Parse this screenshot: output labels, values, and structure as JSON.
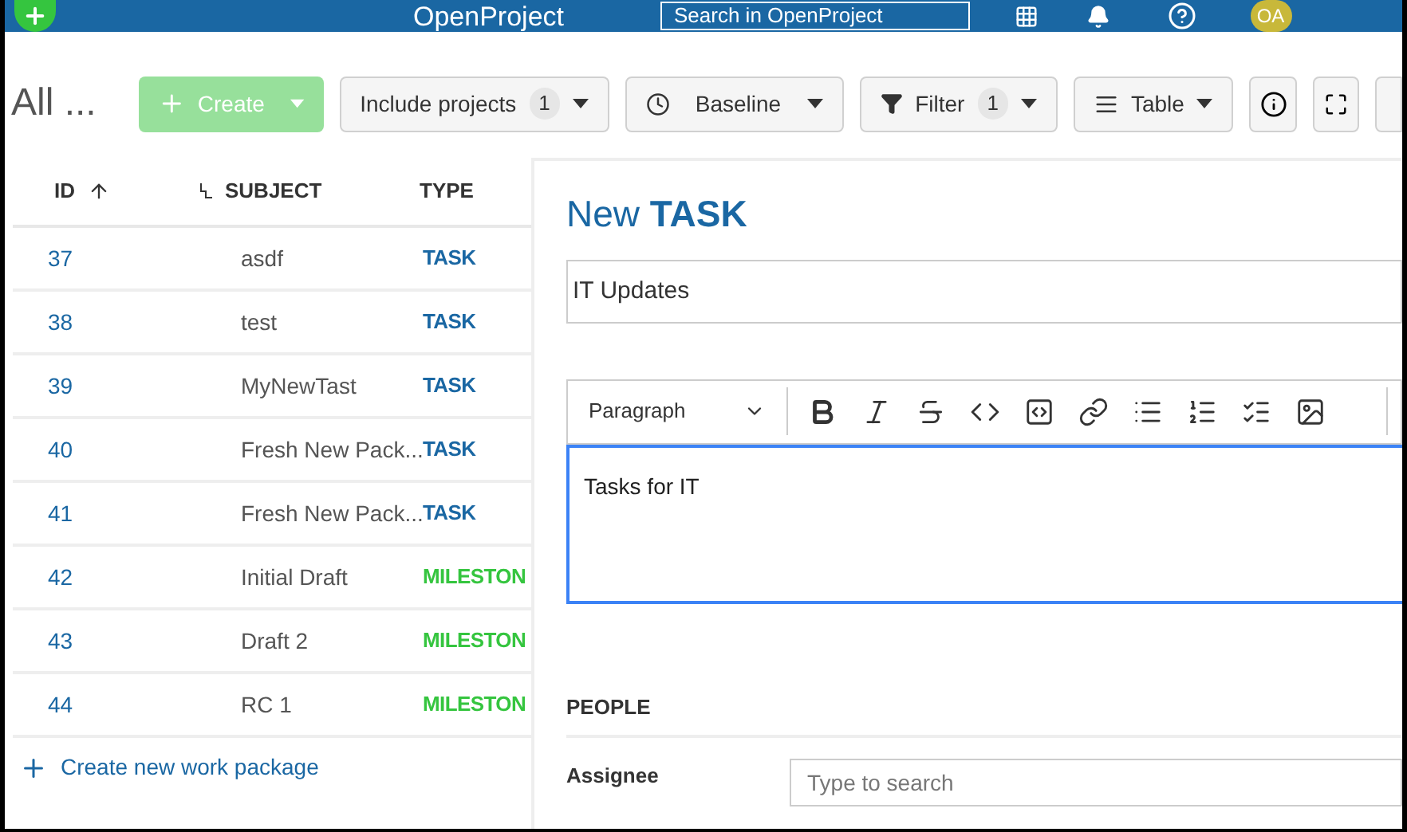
{
  "header": {
    "logo": "OpenProject",
    "search": {
      "placeholder": "Search in OpenProject"
    },
    "avatar": "OA"
  },
  "toolbar": {
    "title": "All ...",
    "create": "Create",
    "include_projects": {
      "label": "Include projects",
      "count": "1"
    },
    "baseline": "Baseline",
    "filter": {
      "label": "Filter",
      "count": "1"
    },
    "view": "Table"
  },
  "table": {
    "columns": [
      "ID",
      "SUBJECT",
      "TYPE"
    ],
    "rows": [
      {
        "id": "37",
        "subject": "asdf",
        "type": "TASK",
        "color": "#1a67a3"
      },
      {
        "id": "38",
        "subject": "test",
        "type": "TASK",
        "color": "#1a67a3"
      },
      {
        "id": "39",
        "subject": "MyNewTast",
        "type": "TASK",
        "color": "#1a67a3"
      },
      {
        "id": "40",
        "subject": "Fresh New Pack...",
        "type": "TASK",
        "color": "#1a67a3"
      },
      {
        "id": "41",
        "subject": "Fresh New Pack...",
        "type": "TASK",
        "color": "#1a67a3"
      },
      {
        "id": "42",
        "subject": "Initial Draft",
        "type": "MILESTON",
        "color": "#35c53f"
      },
      {
        "id": "43",
        "subject": "Draft 2",
        "type": "MILESTON",
        "color": "#35c53f"
      },
      {
        "id": "44",
        "subject": "RC 1",
        "type": "MILESTON",
        "color": "#35c53f"
      }
    ],
    "create_link": "Create new work package"
  },
  "form": {
    "title_prefix": "New",
    "title_type": "TASK",
    "subject": "IT Updates",
    "editor": {
      "style": "Paragraph",
      "text": "Tasks for IT"
    },
    "section": "PEOPLE",
    "assignee": {
      "label": "Assignee",
      "placeholder": "Type to search"
    }
  }
}
